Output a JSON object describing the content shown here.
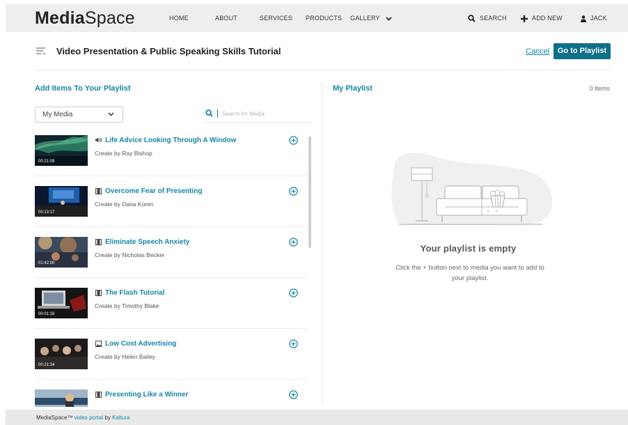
{
  "app": {
    "logo_bold": "Media",
    "logo_light": "Space"
  },
  "nav": {
    "items": [
      "HOME",
      "ABOUT",
      "SERVICES",
      "PRODUCTS",
      "GALLERY"
    ],
    "search_label": "SEARCH",
    "add_new_label": "ADD NEW",
    "user_label": "JACK"
  },
  "header": {
    "title": "Video Presentation & Public Speaking Skills Tutorial",
    "cancel_label": "Cancel",
    "go_label": "Go to Playlist"
  },
  "left": {
    "title": "Add Items To Your Playlist",
    "filter_value": "My Media",
    "search_placeholder": "Search for Media",
    "items": [
      {
        "title": "Life Advice Looking Through A Window",
        "creator": "Create by Ray Bishop",
        "duration": "00:21:09",
        "type_icon": "audio-icon"
      },
      {
        "title": "Overcome Fear of Presenting",
        "creator": "Create by Dana Koren",
        "duration": "00:13:17",
        "type_icon": "video-icon"
      },
      {
        "title": "Eliminate Speech Anxiety",
        "creator": "Create by Nicholas Becker",
        "duration": "01:42:00",
        "type_icon": "video-icon"
      },
      {
        "title": "The Flash Tutorial",
        "creator": "Create by Timothy Blake",
        "duration": "00:01:18",
        "type_icon": "video-icon"
      },
      {
        "title": "Low Cost Advertising",
        "creator": "Create by Helen Bailey",
        "duration": "00:21:34",
        "type_icon": "image-icon"
      },
      {
        "title": "Presenting Like a Winner",
        "creator": "",
        "duration": "",
        "type_icon": "video-icon"
      }
    ]
  },
  "right": {
    "title": "My Playlist",
    "count": "0 Items",
    "empty_title": "Your playlist is empty",
    "empty_text": "Click the + button next to media you want to add to your playlist."
  },
  "footer": {
    "brand": "MediaSpace™",
    "link1": "video portal",
    "by": "by",
    "link2": "Kaltura"
  },
  "colors": {
    "accent": "#1685a8",
    "button": "#0e6f8a",
    "topbar": "#eeeeee"
  }
}
